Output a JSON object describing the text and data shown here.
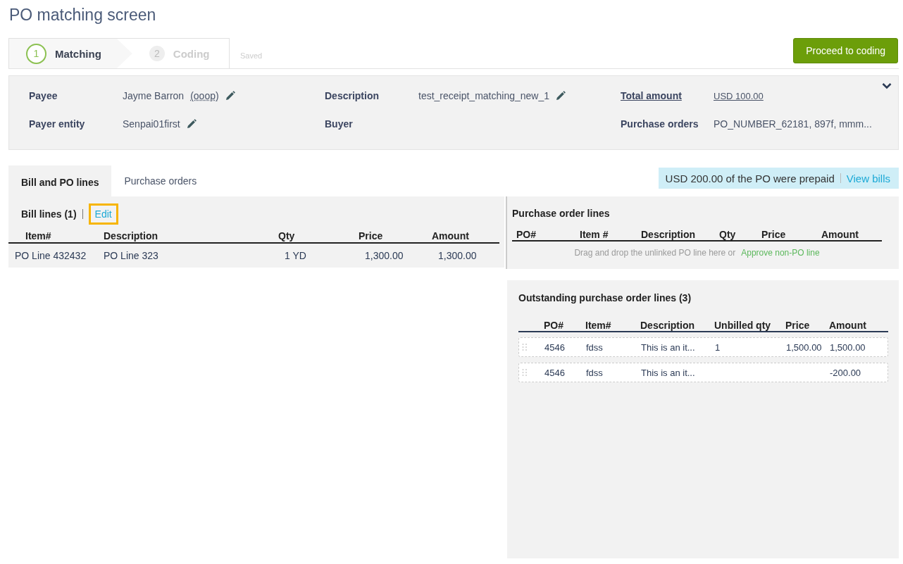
{
  "page_title": "PO matching screen",
  "steps": [
    {
      "number": "1",
      "label": "Matching",
      "selected": true
    },
    {
      "number": "2",
      "label": "Coding",
      "selected": false
    }
  ],
  "save_status": "Saved",
  "primary_button": "Proceed to coding",
  "summary": {
    "columns": [
      [
        {
          "label": "Payee",
          "value": "Jayme Barron",
          "link": "(ooop)",
          "editable": true
        },
        {
          "label": "Payer entity",
          "value": "Senpai01first",
          "editable": true
        }
      ],
      [
        {
          "label": "Description",
          "value": "test_receipt_matching_new_1",
          "editable": true
        },
        {
          "label": "Buyer",
          "editable": false
        }
      ],
      [
        {
          "label": "Total amount",
          "value": "USD 100.00",
          "underlined": true,
          "editable": false
        },
        {
          "label": "Purchase orders",
          "value": "PO_NUMBER_62181, 897f, mmm...",
          "editable": false
        }
      ]
    ]
  },
  "tabs": [
    {
      "label": "Bill and PO lines",
      "selected": true
    },
    {
      "label": "Purchase orders",
      "selected": false
    }
  ],
  "prepaid_banner": {
    "text": "USD 200.00 of the PO were prepaid",
    "link": "View bills"
  },
  "bill_lines": {
    "title": "Bill lines (1)",
    "edit_link": "Edit",
    "highlighted": true,
    "columns": [
      "Item#",
      "Description",
      "Qty",
      "Price",
      "Amount"
    ],
    "rows": [
      [
        "PO Line 432432",
        "PO Line 323",
        "1 YD",
        "1,300.00",
        "1,300.00"
      ]
    ]
  },
  "po_lines": {
    "title": "Purchase order lines",
    "columns": [
      "PO#",
      "Item #",
      "Description",
      "Qty",
      "Price",
      "Amount"
    ],
    "empty_text": "Drag and drop the unlinked PO line here or",
    "empty_link": "Approve non-PO line"
  },
  "outstanding": {
    "title": "Outstanding purchase order lines (3)",
    "columns": [
      "PO#",
      "Item#",
      "Description",
      "Unbilled qty",
      "Price",
      "Amount"
    ],
    "rows": [
      [
        "4546",
        "fdss",
        "This is an it...",
        "1",
        "1,500.00",
        "1,500.00"
      ],
      [
        "4546",
        "fdss",
        "This is an it...",
        "",
        "",
        "-200.00"
      ]
    ]
  }
}
